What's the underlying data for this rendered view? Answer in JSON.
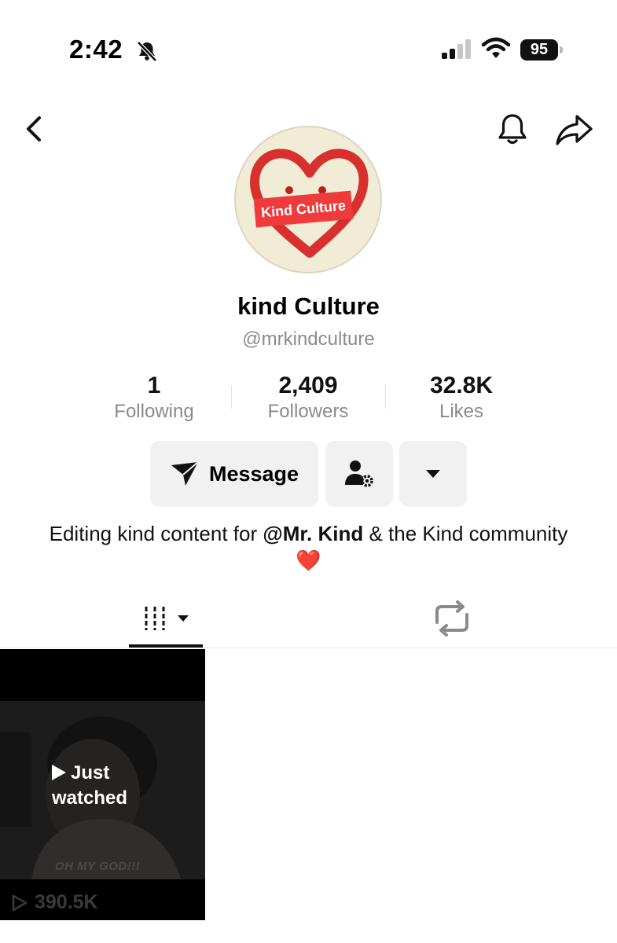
{
  "status_bar": {
    "time": "2:42",
    "battery": "95"
  },
  "avatar": {
    "label": "Kind Culture"
  },
  "profile": {
    "display_name": "kind Culture",
    "username": "@mrkindculture"
  },
  "stats": [
    {
      "value": "1",
      "label": "Following"
    },
    {
      "value": "2,409",
      "label": "Followers"
    },
    {
      "value": "32.8K",
      "label": "Likes"
    }
  ],
  "actions": {
    "message_label": "Message"
  },
  "bio": {
    "before": "Editing kind content for ",
    "mention": "@Mr. Kind",
    "after": " & the Kind community ",
    "emoji": "❤️"
  },
  "videos": [
    {
      "overlay_line1": "Just",
      "overlay_line2": "watched",
      "caption": "OH MY GOD!!!",
      "views": "390.5K"
    }
  ],
  "icons": {
    "back": "chevron-left-icon",
    "notify": "bell-icon",
    "share": "share-arrow-icon",
    "silent": "bell-slash-icon",
    "message": "paper-plane-icon",
    "friend_settings": "user-gear-icon",
    "more": "caret-down-icon",
    "videos_tab": "grid-icon",
    "reposts_tab": "repost-icon",
    "play": "play-icon"
  },
  "colors": {
    "accent_red": "#ef3b3b",
    "muted_text": "#8a8a8a",
    "button_bg": "#f1f1f1"
  }
}
